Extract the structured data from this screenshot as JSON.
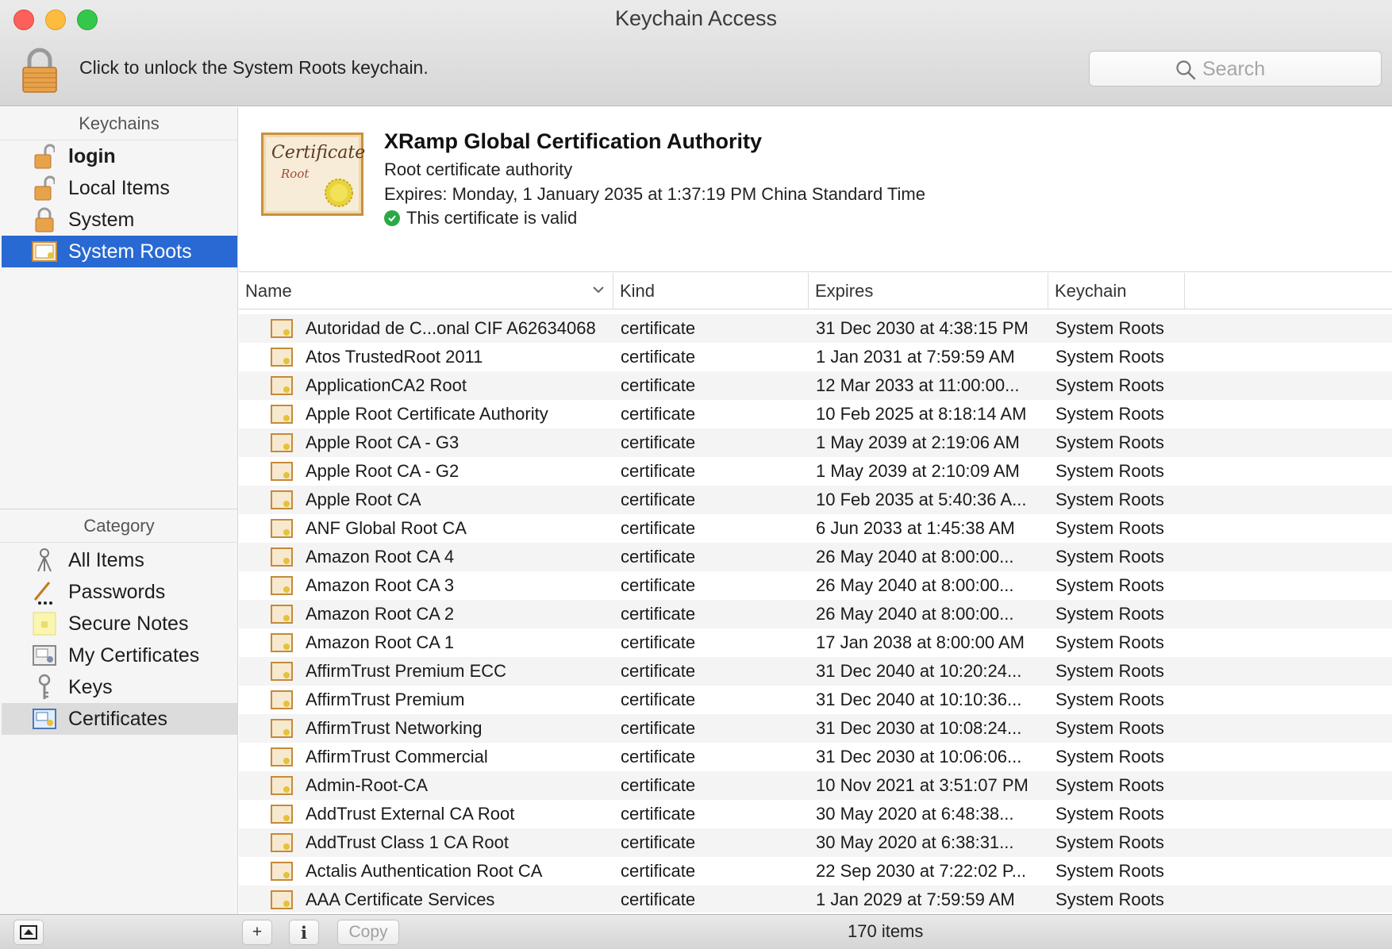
{
  "window": {
    "title": "Keychain Access",
    "unlock_message": "Click to unlock the System Roots keychain."
  },
  "search": {
    "placeholder": "Search",
    "value": ""
  },
  "sidebar": {
    "keychains_header": "Keychains",
    "keychains": [
      {
        "label": "login",
        "icon": "unlocked-padlock-icon"
      },
      {
        "label": "Local Items",
        "icon": "unlocked-padlock-icon"
      },
      {
        "label": "System",
        "icon": "padlock-icon"
      },
      {
        "label": "System Roots",
        "icon": "certificate-cabinet-icon"
      }
    ],
    "category_header": "Category",
    "categories": [
      {
        "label": "All Items",
        "icon": "all-items-icon"
      },
      {
        "label": "Passwords",
        "icon": "pen-icon"
      },
      {
        "label": "Secure Notes",
        "icon": "note-icon"
      },
      {
        "label": "My Certificates",
        "icon": "my-certificate-icon"
      },
      {
        "label": "Keys",
        "icon": "key-icon"
      },
      {
        "label": "Certificates",
        "icon": "certificate-icon"
      }
    ]
  },
  "certificate": {
    "icon_text_top": "Certificate",
    "icon_text_bottom": "Root",
    "title": "XRamp Global Certification Authority",
    "type": "Root certificate authority",
    "expires": "Expires: Monday, 1 January 2035 at 1:37:19 PM China Standard Time",
    "status": "This certificate is valid"
  },
  "table": {
    "columns": {
      "name": "Name",
      "kind": "Kind",
      "expires": "Expires",
      "keychain": "Keychain"
    },
    "rows": [
      {
        "name": "Autoridad de C...onal CIF A62634068",
        "kind": "certificate",
        "expires": "31 Dec 2030 at 4:38:15 PM",
        "keychain": "System Roots"
      },
      {
        "name": "Atos TrustedRoot 2011",
        "kind": "certificate",
        "expires": "1 Jan 2031 at 7:59:59 AM",
        "keychain": "System Roots"
      },
      {
        "name": "ApplicationCA2 Root",
        "kind": "certificate",
        "expires": "12 Mar 2033 at 11:00:00...",
        "keychain": "System Roots"
      },
      {
        "name": "Apple Root Certificate Authority",
        "kind": "certificate",
        "expires": "10 Feb 2025 at 8:18:14 AM",
        "keychain": "System Roots"
      },
      {
        "name": "Apple Root CA - G3",
        "kind": "certificate",
        "expires": "1 May 2039 at 2:19:06 AM",
        "keychain": "System Roots"
      },
      {
        "name": "Apple Root CA - G2",
        "kind": "certificate",
        "expires": "1 May 2039 at 2:10:09 AM",
        "keychain": "System Roots"
      },
      {
        "name": "Apple Root CA",
        "kind": "certificate",
        "expires": "10 Feb 2035 at 5:40:36 A...",
        "keychain": "System Roots"
      },
      {
        "name": "ANF Global Root CA",
        "kind": "certificate",
        "expires": "6 Jun 2033 at 1:45:38 AM",
        "keychain": "System Roots"
      },
      {
        "name": "Amazon Root CA 4",
        "kind": "certificate",
        "expires": "26 May 2040 at 8:00:00...",
        "keychain": "System Roots"
      },
      {
        "name": "Amazon Root CA 3",
        "kind": "certificate",
        "expires": "26 May 2040 at 8:00:00...",
        "keychain": "System Roots"
      },
      {
        "name": "Amazon Root CA 2",
        "kind": "certificate",
        "expires": "26 May 2040 at 8:00:00...",
        "keychain": "System Roots"
      },
      {
        "name": "Amazon Root CA 1",
        "kind": "certificate",
        "expires": "17 Jan 2038 at 8:00:00 AM",
        "keychain": "System Roots"
      },
      {
        "name": "AffirmTrust Premium ECC",
        "kind": "certificate",
        "expires": "31 Dec 2040 at 10:20:24...",
        "keychain": "System Roots"
      },
      {
        "name": "AffirmTrust Premium",
        "kind": "certificate",
        "expires": "31 Dec 2040 at 10:10:36...",
        "keychain": "System Roots"
      },
      {
        "name": "AffirmTrust Networking",
        "kind": "certificate",
        "expires": "31 Dec 2030 at 10:08:24...",
        "keychain": "System Roots"
      },
      {
        "name": "AffirmTrust Commercial",
        "kind": "certificate",
        "expires": "31 Dec 2030 at 10:06:06...",
        "keychain": "System Roots"
      },
      {
        "name": "Admin-Root-CA",
        "kind": "certificate",
        "expires": "10 Nov 2021 at 3:51:07 PM",
        "keychain": "System Roots"
      },
      {
        "name": "AddTrust External CA Root",
        "kind": "certificate",
        "expires": "30 May 2020 at 6:48:38...",
        "keychain": "System Roots"
      },
      {
        "name": "AddTrust Class 1 CA Root",
        "kind": "certificate",
        "expires": "30 May 2020 at 6:38:31...",
        "keychain": "System Roots"
      },
      {
        "name": "Actalis Authentication Root CA",
        "kind": "certificate",
        "expires": "22 Sep 2030 at 7:22:02 P...",
        "keychain": "System Roots"
      },
      {
        "name": "AAA Certificate Services",
        "kind": "certificate",
        "expires": "1 Jan 2029 at 7:59:59 AM",
        "keychain": "System Roots"
      }
    ]
  },
  "bottombar": {
    "add_label": "+",
    "info_label": "i",
    "copy_label": "Copy",
    "item_count": "170 items"
  },
  "colors": {
    "selection": "#2869d3",
    "valid": "#2aa944",
    "cert_border": "#c9903f"
  }
}
